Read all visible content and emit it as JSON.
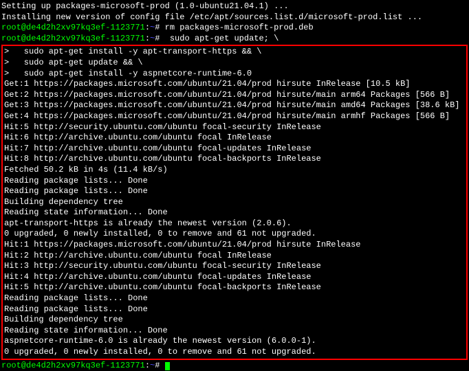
{
  "pre_lines": [
    "Setting up packages-microsoft-prod (1.0-ubuntu21.04.1) ...",
    "Installing new version of config file /etc/apt/sources.list.d/microsoft-prod.list ..."
  ],
  "prompt": {
    "user_host": "root@de4d2h2xv97kq3ef-1123771",
    "colon": ":",
    "path": "~",
    "hash": "#"
  },
  "commands": [
    " rm packages-microsoft-prod.deb",
    "  sudo apt-get update; \\"
  ],
  "boxed_lines": [
    ">   sudo apt-get install -y apt-transport-https && \\",
    ">   sudo apt-get update && \\",
    ">   sudo apt-get install -y aspnetcore-runtime-6.0",
    "Get:1 https://packages.microsoft.com/ubuntu/21.04/prod hirsute InRelease [10.5 kB]",
    "Get:2 https://packages.microsoft.com/ubuntu/21.04/prod hirsute/main arm64 Packages [566 B]",
    "Get:3 https://packages.microsoft.com/ubuntu/21.04/prod hirsute/main amd64 Packages [38.6 kB]",
    "Get:4 https://packages.microsoft.com/ubuntu/21.04/prod hirsute/main armhf Packages [566 B]",
    "Hit:5 http://security.ubuntu.com/ubuntu focal-security InRelease",
    "Hit:6 http://archive.ubuntu.com/ubuntu focal InRelease",
    "Hit:7 http://archive.ubuntu.com/ubuntu focal-updates InRelease",
    "Hit:8 http://archive.ubuntu.com/ubuntu focal-backports InRelease",
    "Fetched 50.2 kB in 4s (11.4 kB/s)",
    "Reading package lists... Done",
    "Reading package lists... Done",
    "Building dependency tree",
    "Reading state information... Done",
    "apt-transport-https is already the newest version (2.0.6).",
    "0 upgraded, 0 newly installed, 0 to remove and 61 not upgraded.",
    "Hit:1 https://packages.microsoft.com/ubuntu/21.04/prod hirsute InRelease",
    "Hit:2 http://archive.ubuntu.com/ubuntu focal InRelease",
    "Hit:3 http://security.ubuntu.com/ubuntu focal-security InRelease",
    "Hit:4 http://archive.ubuntu.com/ubuntu focal-updates InRelease",
    "Hit:5 http://archive.ubuntu.com/ubuntu focal-backports InRelease",
    "Reading package lists... Done",
    "Reading package lists... Done",
    "Building dependency tree",
    "Reading state information... Done",
    "aspnetcore-runtime-6.0 is already the newest version (6.0.0-1).",
    "0 upgraded, 0 newly installed, 0 to remove and 61 not upgraded."
  ],
  "final_command": " "
}
